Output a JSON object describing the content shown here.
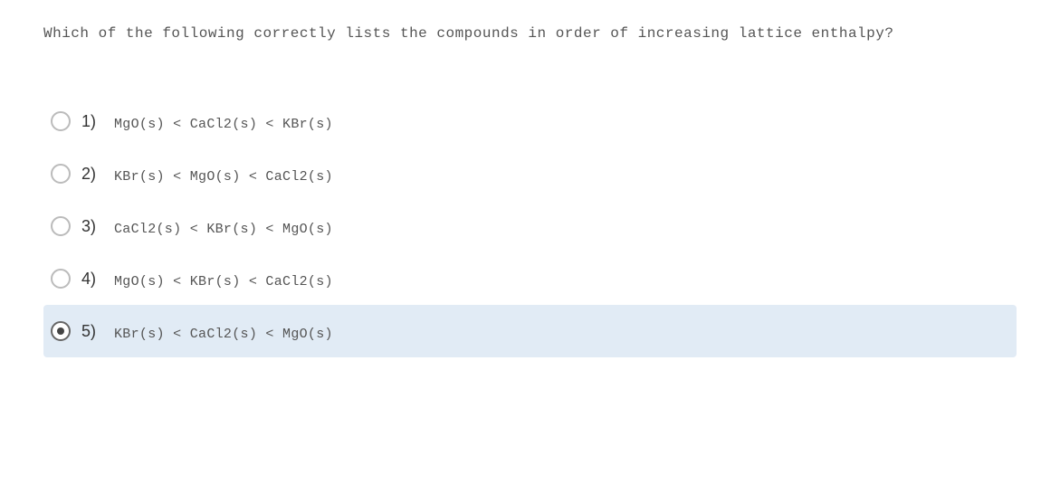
{
  "question": "Which of the following correctly lists the compounds in order of increasing lattice enthalpy?",
  "options": [
    {
      "number": "1)",
      "text": "MgO(s) < CaCl2(s) < KBr(s)",
      "selected": false
    },
    {
      "number": "2)",
      "text": "KBr(s) < MgO(s) < CaCl2(s)",
      "selected": false
    },
    {
      "number": "3)",
      "text": "CaCl2(s) < KBr(s) < MgO(s)",
      "selected": false
    },
    {
      "number": "4)",
      "text": "MgO(s) < KBr(s) < CaCl2(s)",
      "selected": false
    },
    {
      "number": "5)",
      "text": "KBr(s) < CaCl2(s) < MgO(s)",
      "selected": true
    }
  ]
}
